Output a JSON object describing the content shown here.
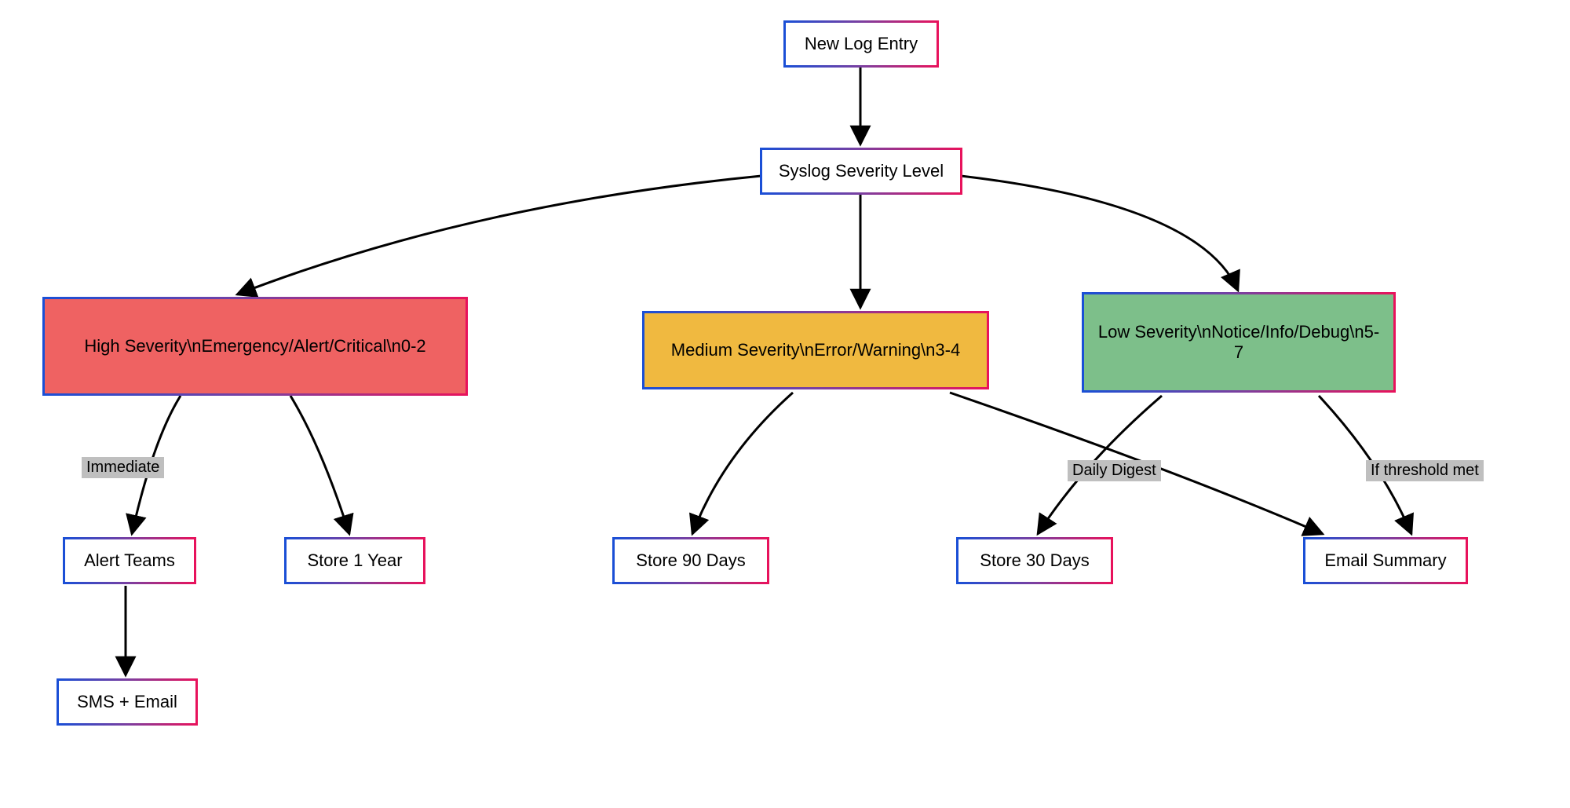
{
  "diagram": {
    "nodes": {
      "new_log_entry": "New Log Entry",
      "syslog_severity": "Syslog Severity Level",
      "high": "High Severity\\nEmergency/Alert/Critical\\n0-2",
      "medium": "Medium Severity\\nError/Warning\\n3-4",
      "low": "Low Severity\\nNotice/Info/Debug\\n5-7",
      "alert_teams": "Alert Teams",
      "store_1_year": "Store 1 Year",
      "store_90_days": "Store 90 Days",
      "store_30_days": "Store 30 Days",
      "email_summary": "Email Summary",
      "sms_email": "SMS + Email"
    },
    "edge_labels": {
      "immediate": "Immediate",
      "daily_digest": "Daily Digest",
      "threshold": "If threshold met"
    }
  }
}
